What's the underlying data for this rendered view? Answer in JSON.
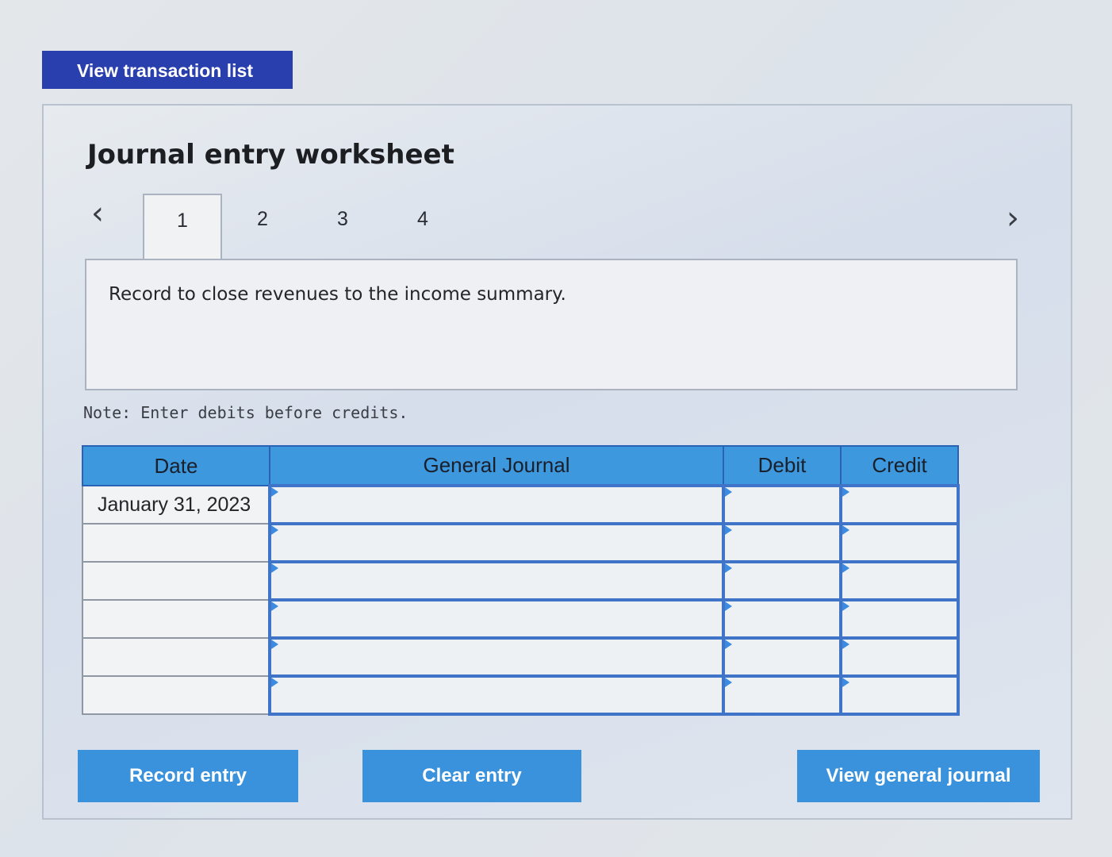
{
  "top_button": {
    "label": "View transaction list"
  },
  "worksheet": {
    "title": "Journal entry worksheet",
    "tabs": [
      "1",
      "2",
      "3",
      "4"
    ],
    "active_tab": "1",
    "prev_icon": "chevron-left-icon",
    "next_icon": "chevron-right-icon",
    "description": "Record to close revenues to the income summary.",
    "note": "Note: Enter debits before credits."
  },
  "journal_table": {
    "headers": {
      "date": "Date",
      "general_journal": "General Journal",
      "debit": "Debit",
      "credit": "Credit"
    },
    "rows": [
      {
        "date": "January 31, 2023",
        "account": "",
        "debit": "",
        "credit": ""
      },
      {
        "date": "",
        "account": "",
        "debit": "",
        "credit": ""
      },
      {
        "date": "",
        "account": "",
        "debit": "",
        "credit": ""
      },
      {
        "date": "",
        "account": "",
        "debit": "",
        "credit": ""
      },
      {
        "date": "",
        "account": "",
        "debit": "",
        "credit": ""
      },
      {
        "date": "",
        "account": "",
        "debit": "",
        "credit": ""
      }
    ]
  },
  "actions": {
    "record_entry": "Record entry",
    "clear_entry": "Clear entry",
    "view_general_journal": "View general journal"
  },
  "colors": {
    "top_button_bg": "#2a3fae",
    "header_bg": "#3d98de",
    "action_button_bg": "#3a92dc",
    "cell_border": "#3f74c9"
  }
}
